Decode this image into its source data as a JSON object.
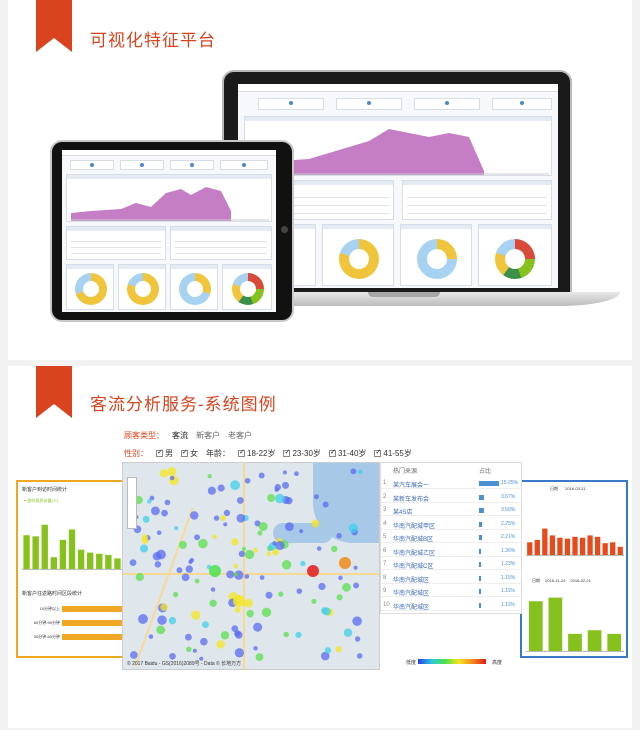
{
  "section1": {
    "title": "可视化特征平台"
  },
  "section2": {
    "title": "客流分析服务-系统图例"
  },
  "filters": {
    "customer_type_label": "顾客类型：",
    "customer_tabs": [
      "客流",
      "新客户",
      "老客户"
    ],
    "gender_label": "性别：",
    "genders": [
      "男",
      "女"
    ],
    "age_label": "年龄：",
    "ages": [
      "18-22岁",
      "23-30岁",
      "31-40岁",
      "41-55岁"
    ]
  },
  "map": {
    "copyright": "© 2017 Baidu - GS(2016)2089号 - Data © 长地万方"
  },
  "hot_list": {
    "header_name": "热门来源",
    "header_pct": "占比",
    "rows": [
      {
        "idx": "1",
        "name": "某汽车展会一",
        "pct": "15.25%",
        "share": 15.25
      },
      {
        "idx": "2",
        "name": "某新车发布会",
        "pct": "3.67%",
        "share": 3.67
      },
      {
        "idx": "3",
        "name": "某4S店",
        "pct": "3.50%",
        "share": 3.5
      },
      {
        "idx": "4",
        "name": "华南汽配城甲区",
        "pct": "2.25%",
        "share": 2.25
      },
      {
        "idx": "5",
        "name": "华南汽配城B区",
        "pct": "2.21%",
        "share": 2.21
      },
      {
        "idx": "6",
        "name": "华南汽配城乙区",
        "pct": "1.36%",
        "share": 1.36
      },
      {
        "idx": "7",
        "name": "华南汽配城C区",
        "pct": "1.23%",
        "share": 1.23
      },
      {
        "idx": "8",
        "name": "华南汽配城区",
        "pct": "1.15%",
        "share": 1.15
      },
      {
        "idx": "9",
        "name": "华南汽配城区",
        "pct": "1.11%",
        "share": 1.11
      },
      {
        "idx": "10",
        "name": "华南汽配城区",
        "pct": "1.11%",
        "share": 1.11
      }
    ]
  },
  "left_card": {
    "title": "新客户到访时间统计",
    "legend": "各时段到访量(人)",
    "title2": "新客户往返路时间区段统计",
    "h_labels": [
      "10分钟以上",
      "60分钟-90分钟",
      "30分钟-60分钟"
    ]
  },
  "right_card": {
    "date_label": "日期",
    "date_value": "2016-03-21",
    "date_label2": "日期",
    "date_value2": "2016-11-24",
    "date_value3": "2016-02-21"
  },
  "heat_legend": {
    "low": "低度",
    "high": "高度"
  },
  "colors": {
    "accent": "#d9431e",
    "bar_green": "#86c11d",
    "bar_orange": "#f0a824",
    "bar_red": "#e84a1c",
    "chart_pink": "#c57dc6",
    "donut_yellow": "#f0c43b",
    "donut_blue": "#a8d2f2"
  },
  "chart_data": [
    {
      "type": "bar",
      "title": "新客户到访时间统计",
      "series": [
        {
          "name": "各时段到访量(人)",
          "values": [
            60,
            58,
            78,
            22,
            52,
            70,
            35,
            30,
            28,
            26,
            20
          ]
        }
      ],
      "ylim": [
        0,
        100
      ]
    },
    {
      "type": "bar",
      "title": "新客户往返路时间区段统计",
      "categories": [
        "10分钟以上",
        "60分钟-90分钟",
        "30分钟-60分钟"
      ],
      "values": [
        100,
        100,
        100
      ]
    },
    {
      "type": "bar",
      "series": [
        {
          "values": [
            30,
            35,
            60,
            45,
            40,
            38,
            42,
            40,
            45,
            42,
            28,
            30,
            20
          ]
        }
      ]
    },
    {
      "type": "bar",
      "series": [
        {
          "values": [
            70,
            75,
            25,
            30,
            25
          ]
        }
      ]
    }
  ]
}
